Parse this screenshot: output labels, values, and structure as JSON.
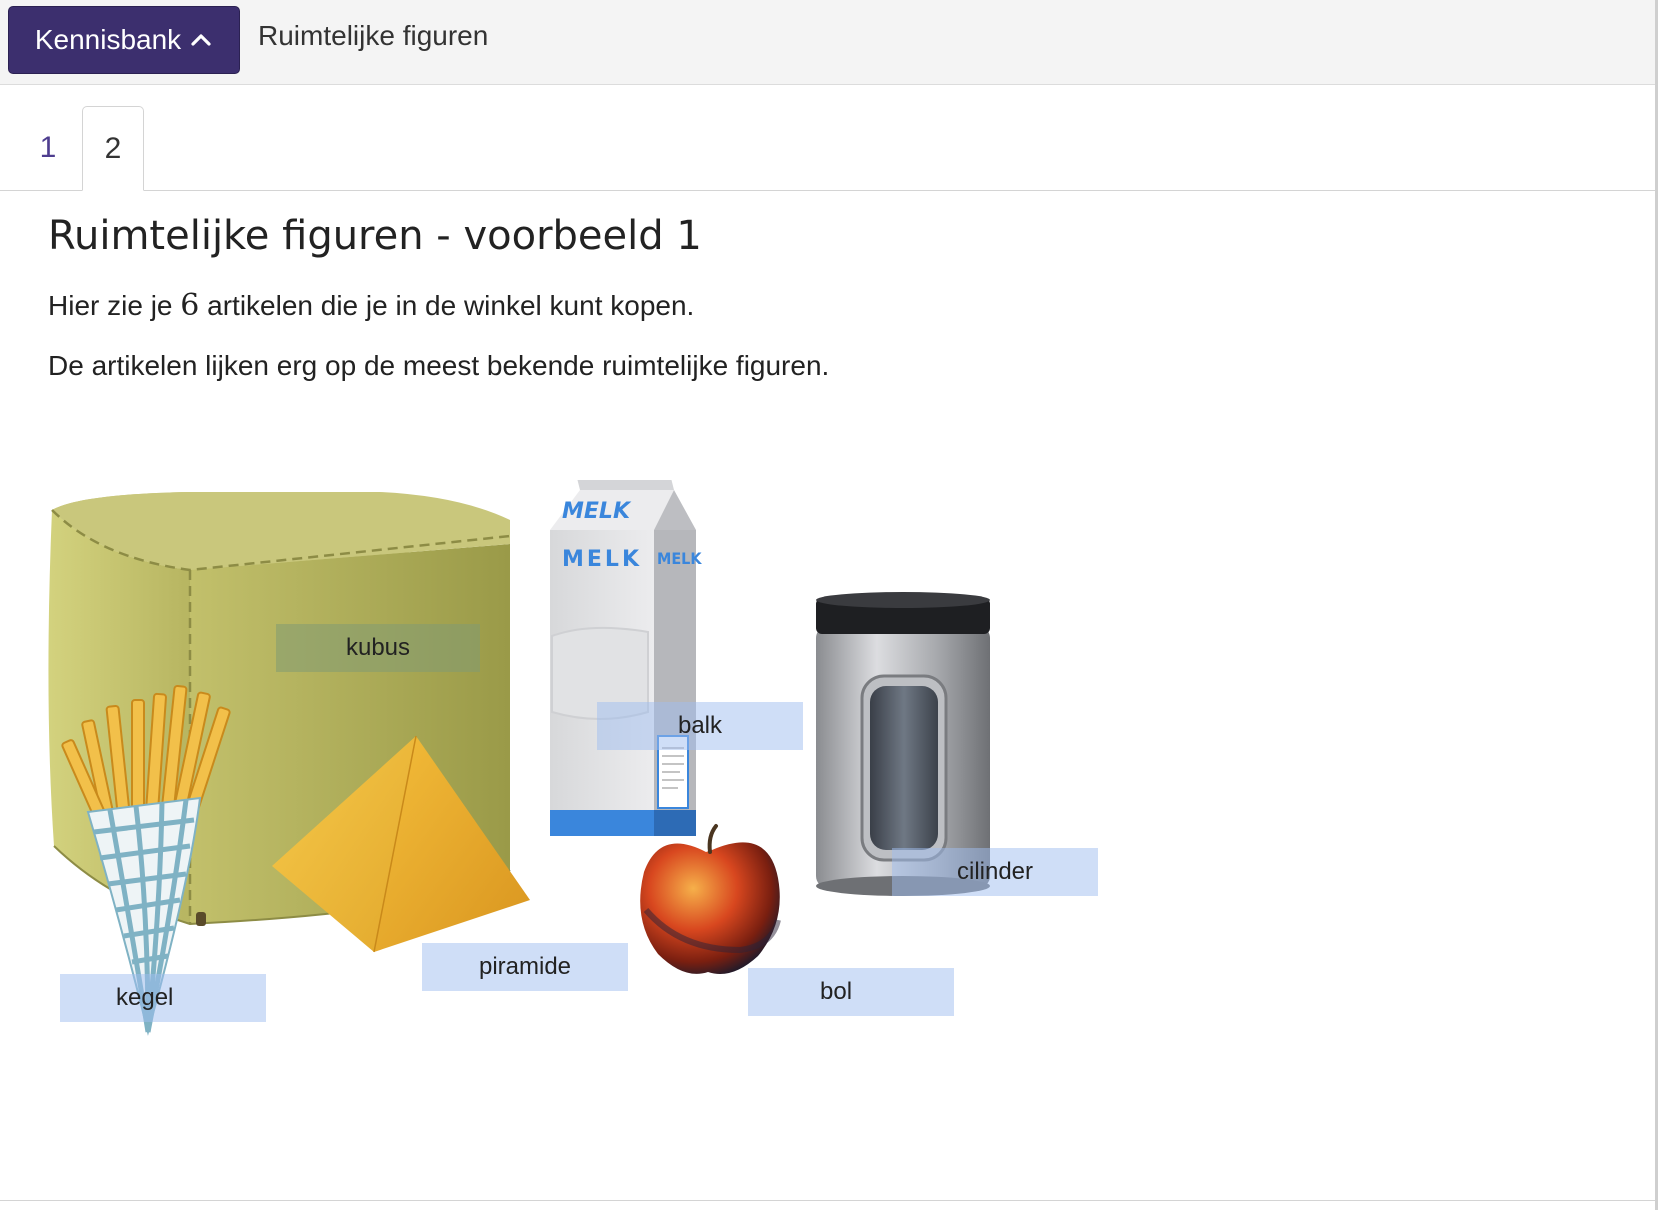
{
  "header": {
    "kennisbank_label": "Kennisbank",
    "kennisbank_icon": "chevron-up-icon",
    "breadcrumb_title": "Ruimtelijke figuren"
  },
  "tabs": [
    {
      "label": "1",
      "active": false
    },
    {
      "label": "2",
      "active": true
    }
  ],
  "content": {
    "title": "Ruimtelijke figuren - voorbeeld 1",
    "para1_before": "Hier zie je ",
    "para1_number": "6",
    "para1_after": " artikelen die je in de winkel kunt kopen.",
    "para2": "De artikelen lijken erg op de meest bekende ruimtelijke figuren."
  },
  "illustration": {
    "carton_text": "MELK",
    "labels": {
      "kubus": "kubus",
      "balk": "balk",
      "cilinder": "cilinder",
      "piramide": "piramide",
      "bol": "bol",
      "kegel": "kegel"
    }
  },
  "colors": {
    "accent": "#3c2f6e",
    "tab_link": "#4e3d8f"
  }
}
